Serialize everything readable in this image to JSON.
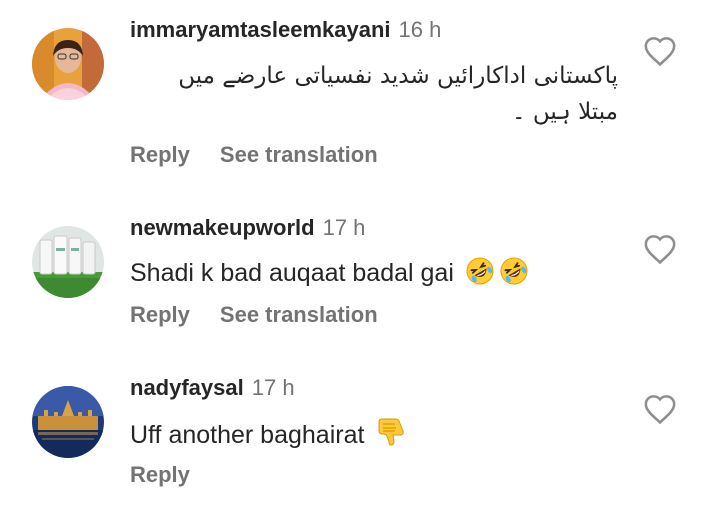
{
  "comments": [
    {
      "username": "immaryamtasleemkayani",
      "time": "16 h",
      "text_line1": "پاکستانی اداکارائیں شدید نفسیاتی عارضے میں",
      "text_line2": "مبتلا ہیں ۔",
      "reply_label": "Reply",
      "translate_label": "See translation"
    },
    {
      "username": "newmakeupworld",
      "time": "17 h",
      "text": "Shadi k bad auqaat badal gai",
      "emojis": [
        "rolling-on-floor-laughing-icon",
        "rolling-on-floor-laughing-icon"
      ],
      "reply_label": "Reply",
      "translate_label": "See translation"
    },
    {
      "username": "nadyfaysal",
      "time": "17 h",
      "text": "Uff another baghairat",
      "emojis": [
        "thumbs-down-icon"
      ],
      "reply_label": "Reply"
    }
  ],
  "colors": {
    "primary_text": "#262626",
    "secondary_text": "#737373",
    "background": "#ffffff"
  }
}
